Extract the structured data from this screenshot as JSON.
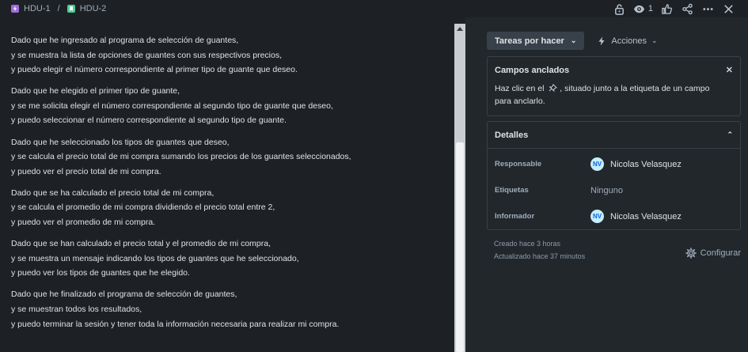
{
  "breadcrumb": {
    "parent": "HDU-1",
    "separator": "/",
    "current": "HDU-2"
  },
  "header": {
    "watch_count": "1"
  },
  "description": {
    "paragraphs": [
      [
        "Dado que he ingresado al programa de selección de guantes,",
        "y  se muestra la lista de opciones de guantes con sus respectivos precios,",
        "y puedo elegir el número correspondiente al primer tipo de guante que deseo."
      ],
      [
        "Dado que he elegido el primer tipo de guante,",
        "y  se me solicita elegir el número correspondiente al segundo tipo de guante que deseo,",
        "y  puedo seleccionar el número correspondiente al segundo tipo de guante."
      ],
      [
        "Dado que he seleccionado los tipos de guantes que deseo,",
        "y se calcula el precio total de mi compra sumando los precios de los guantes seleccionados,",
        "y puedo ver el precio total de mi compra."
      ],
      [
        "Dado que se ha calculado el precio total de mi compra,",
        "y se calcula el promedio de mi compra dividiendo el precio total entre 2,",
        "y puedo ver el promedio de mi compra."
      ],
      [
        "Dado que se han calculado el precio total y el promedio de mi compra,",
        "y se muestra un mensaje indicando los tipos de guantes que he seleccionado,",
        "y puedo ver los tipos de guantes que he elegido."
      ],
      [
        "Dado que he finalizado el programa de selección de guantes,",
        "y se muestran todos los resultados,",
        "y puedo terminar la sesión y tener toda la información necesaria para realizar mi compra."
      ]
    ]
  },
  "panel": {
    "status_label": "Tareas por hacer",
    "actions_label": "Acciones",
    "pinned": {
      "title": "Campos anclados",
      "text_1": "Haz clic en el",
      "text_2": ", situado junto a la etiqueta de un campo",
      "text_3": "para anclarlo."
    },
    "details": {
      "title": "Detalles",
      "rows": [
        {
          "label": "Responsable",
          "value": "Nicolas Velasquez",
          "avatar": "NV"
        },
        {
          "label": "Etiquetas",
          "value": "Ninguno"
        },
        {
          "label": "Informador",
          "value": "Nicolas Velasquez",
          "avatar": "NV"
        }
      ]
    },
    "created": "Creado hace 3 horas",
    "updated": "Actualizado hace 37 minutos",
    "configure_label": "Configurar"
  },
  "colors": {
    "epic": "#9f6bde",
    "story": "#4bce97",
    "background": "#1d2125",
    "panel": "#22272b"
  }
}
